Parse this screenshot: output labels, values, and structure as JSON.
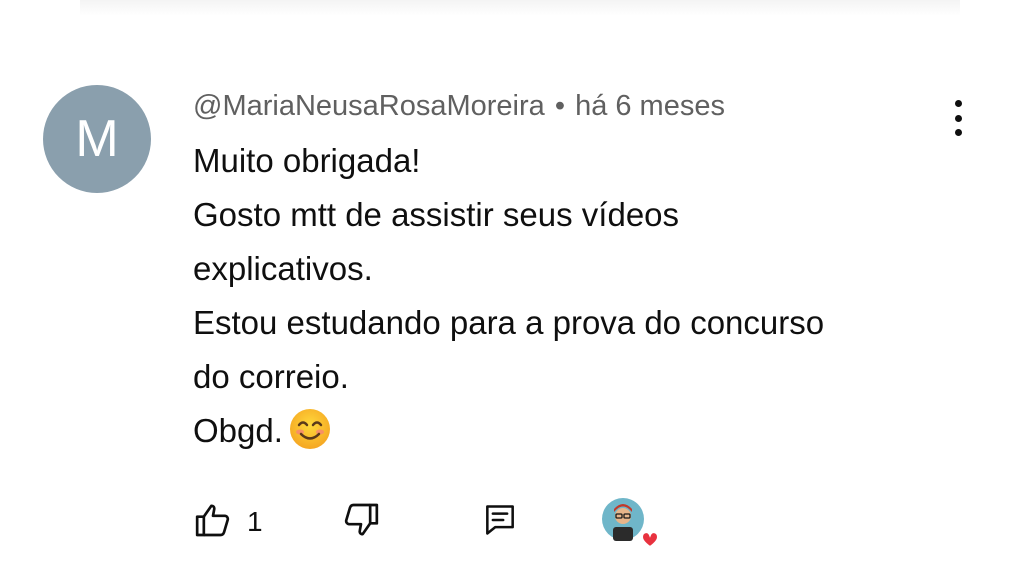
{
  "comment": {
    "avatar_letter": "M",
    "author": "@MariaNeusaRosaMoreira",
    "separator": "•",
    "time": "há 6 meses",
    "lines": [
      "Muito obrigada!",
      "Gosto mtt de assistir seus vídeos",
      "explicativos.",
      "Estou estudando para a prova do concurso",
      "do correio.",
      "Obgd."
    ],
    "emoji": "smiling-face-emoji",
    "like_count": "1"
  },
  "colors": {
    "avatar_bg": "#8a9fad",
    "meta_text": "#606060",
    "heart": "#e8323f"
  },
  "icons": {
    "more": "vertical-ellipsis-icon",
    "like": "thumbs-up-icon",
    "dislike": "thumbs-down-icon",
    "reply": "comment-icon",
    "hearted": "creator-heart-icon"
  }
}
